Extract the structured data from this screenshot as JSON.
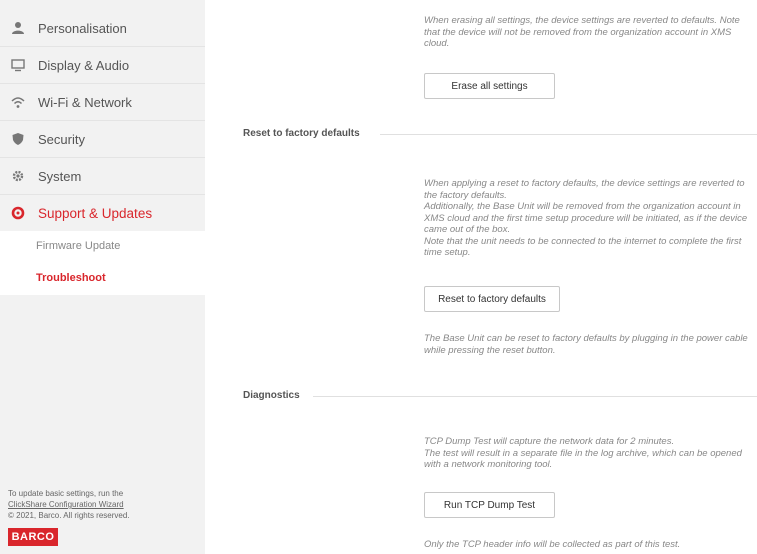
{
  "sidebar": {
    "items": [
      {
        "label": "Personalisation",
        "icon": "person-icon"
      },
      {
        "label": "Display & Audio",
        "icon": "monitor-icon"
      },
      {
        "label": "Wi-Fi & Network",
        "icon": "wifi-icon"
      },
      {
        "label": "Security",
        "icon": "shield-icon"
      },
      {
        "label": "System",
        "icon": "gear-icon"
      },
      {
        "label": "Support & Updates",
        "icon": "lifebuoy-icon"
      }
    ],
    "sub_items": [
      {
        "label": "Firmware Update"
      },
      {
        "label": "Troubleshoot"
      }
    ],
    "footer": {
      "line1": "To update basic settings, run the",
      "link": "ClickShare Configuration Wizard",
      "copyright": "© 2021, Barco. All rights reserved."
    },
    "logo": "BARCO"
  },
  "main": {
    "erase": {
      "description": "When erasing all settings, the device settings are reverted to defaults. Note that the device will not be removed from the organization account in XMS cloud.",
      "button": "Erase all settings"
    },
    "factory": {
      "title": "Reset to factory defaults",
      "description": "When applying a reset to factory defaults, the device settings are reverted to the factory defaults.\nAdditionally, the Base Unit will be removed from the organization account in XMS cloud and the first time setup procedure will be initiated, as if the device came out of the box.\nNote that the unit needs to be connected to the internet to complete the first time setup.",
      "button": "Reset to factory defaults",
      "note": "The Base Unit can be reset to factory defaults by plugging in the power cable while pressing the reset button."
    },
    "diagnostics": {
      "title": "Diagnostics",
      "description": "TCP Dump Test will capture the network data for 2 minutes.\nThe test will result in a separate file in the log archive, which can be opened with a network monitoring tool.",
      "button": "Run TCP Dump Test",
      "note": "Only the TCP header info will be collected as part of this test."
    }
  },
  "colors": {
    "accent": "#d9262c",
    "sidebar_bg": "#f2f2f2"
  }
}
